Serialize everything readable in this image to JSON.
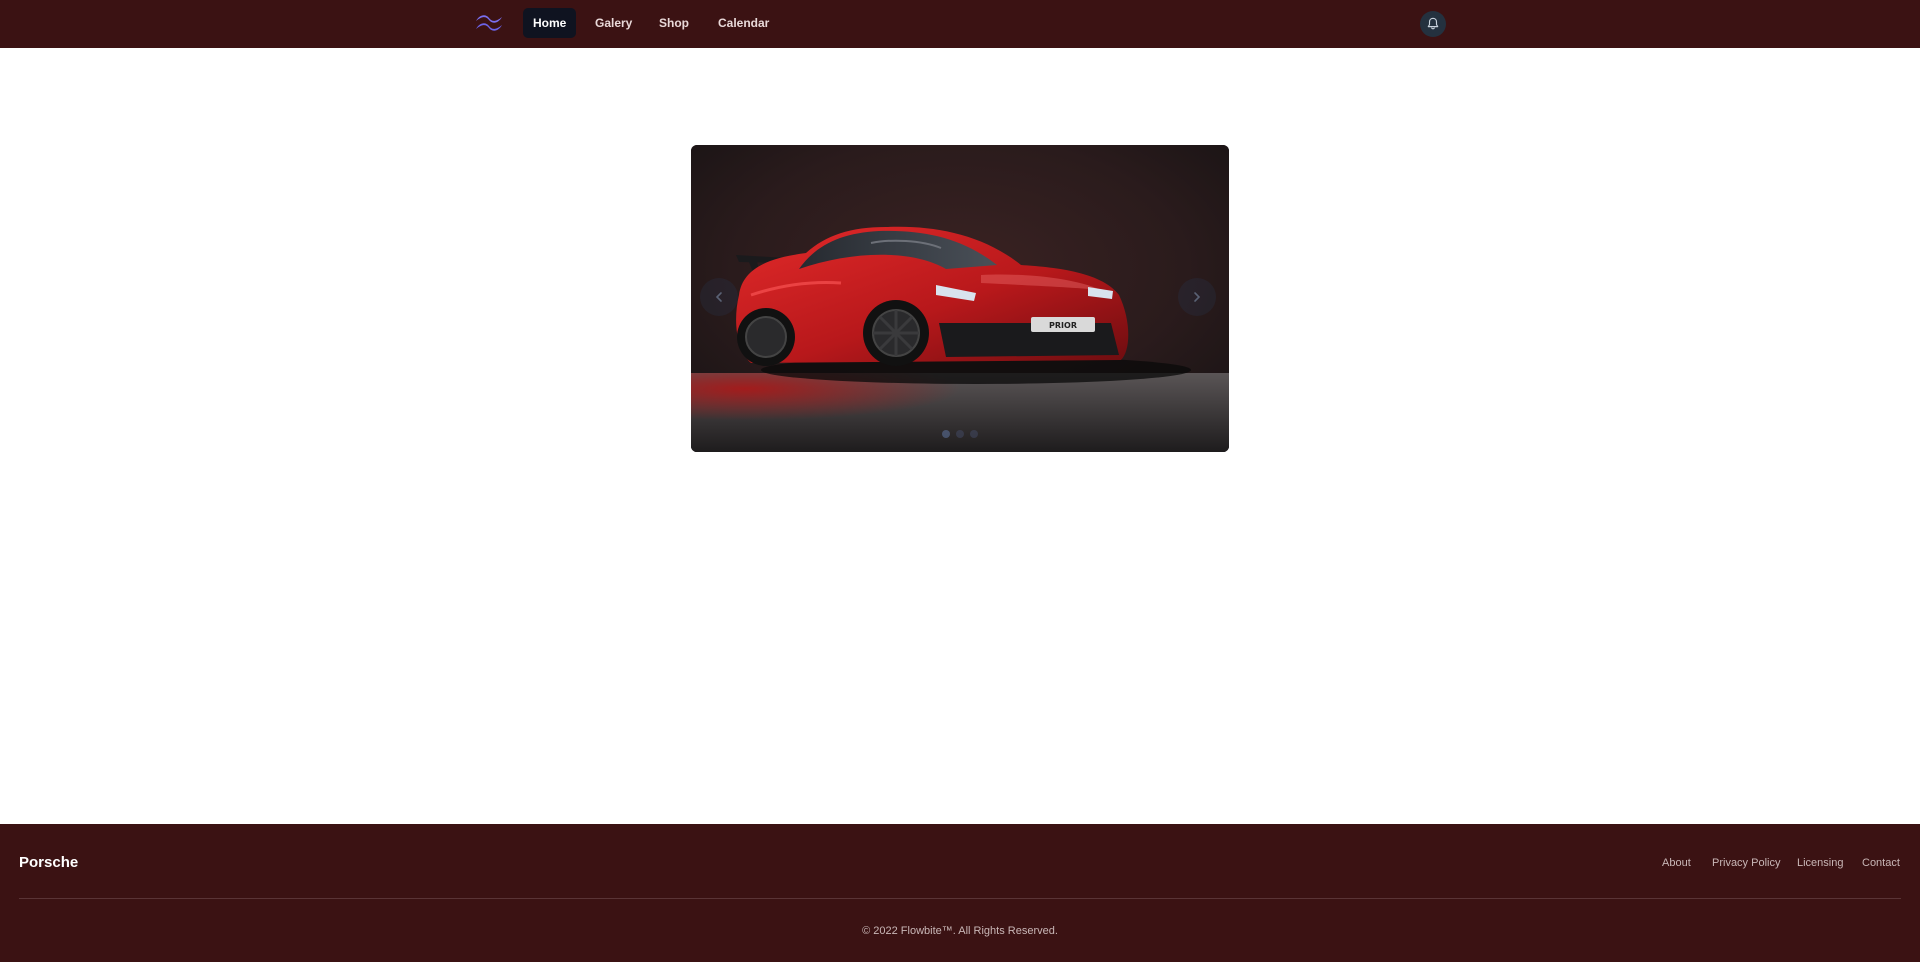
{
  "nav": {
    "items": [
      {
        "label": "Home",
        "active": true
      },
      {
        "label": "Galery",
        "active": false
      },
      {
        "label": "Shop",
        "active": false
      },
      {
        "label": "Calendar",
        "active": false
      }
    ],
    "logo_icon": "tailwind-logo-icon",
    "notification_icon": "bell-icon"
  },
  "carousel": {
    "prev_icon": "chevron-left-icon",
    "next_icon": "chevron-right-icon",
    "slide_count": 3,
    "active_slide": 1,
    "plate_text": "PRIOR"
  },
  "footer": {
    "brand": "Porsche",
    "links": [
      "About",
      "Privacy Policy",
      "Licensing",
      "Contact"
    ],
    "copyright": "© 2022 Flowbite™. All Rights Reserved."
  },
  "colors": {
    "nav_bg": "#3b1213",
    "footer_bg": "#3b1213",
    "active_nav_bg": "#0f1320",
    "page_bg": "#ffffff",
    "logo_accent": "#7a6ff0"
  }
}
